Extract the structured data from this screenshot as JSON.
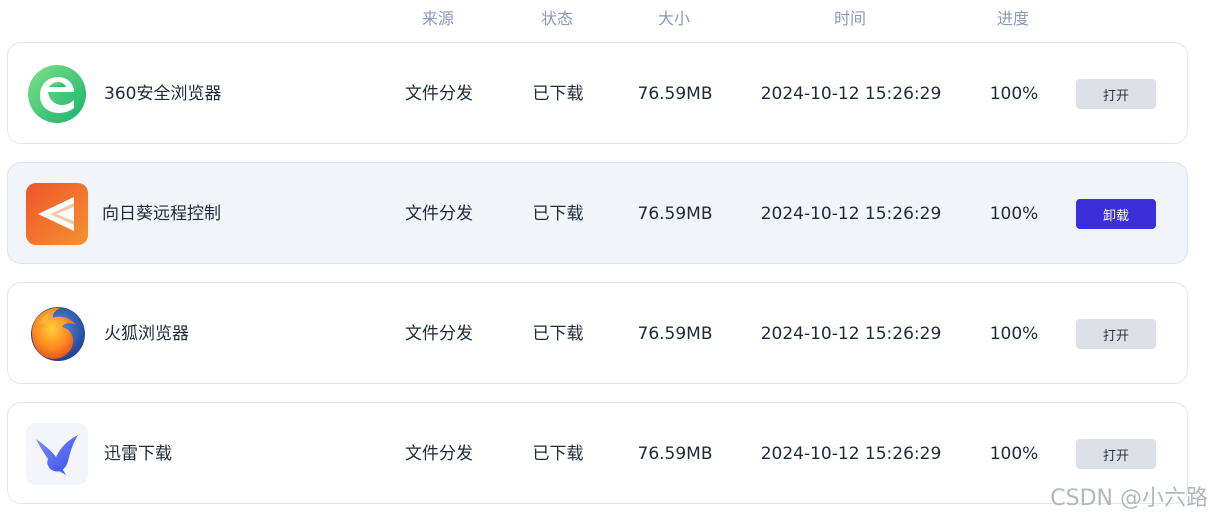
{
  "header": {
    "source": "来源",
    "status": "状态",
    "size": "大小",
    "time": "时间",
    "progress": "进度"
  },
  "rows": [
    {
      "name": "360安全浏览器",
      "icon": "360-browser-icon",
      "source": "文件分发",
      "status": "已下载",
      "size": "76.59MB",
      "time": "2024-10-12 15:26:29",
      "progress": "100%",
      "action": "打开",
      "highlighted": false
    },
    {
      "name": "向日葵远程控制",
      "icon": "sunlogin-icon",
      "source": "文件分发",
      "status": "已下载",
      "size": "76.59MB",
      "time": "2024-10-12 15:26:29",
      "progress": "100%",
      "action": "卸载",
      "highlighted": true
    },
    {
      "name": "火狐浏览器",
      "icon": "firefox-icon",
      "source": "文件分发",
      "status": "已下载",
      "size": "76.59MB",
      "time": "2024-10-12 15:26:29",
      "progress": "100%",
      "action": "打开",
      "highlighted": false
    },
    {
      "name": "迅雷下载",
      "icon": "xunlei-icon",
      "source": "文件分发",
      "status": "已下载",
      "size": "76.59MB",
      "time": "2024-10-12 15:26:29",
      "progress": "100%",
      "action": "打开",
      "highlighted": false
    }
  ],
  "watermark": "CSDN @小六路",
  "colors": {
    "header_text": "#8a9bb8",
    "primary_button": "#3b2fd9",
    "secondary_button": "#dde1e7",
    "highlight_row": "#f1f5fa"
  }
}
